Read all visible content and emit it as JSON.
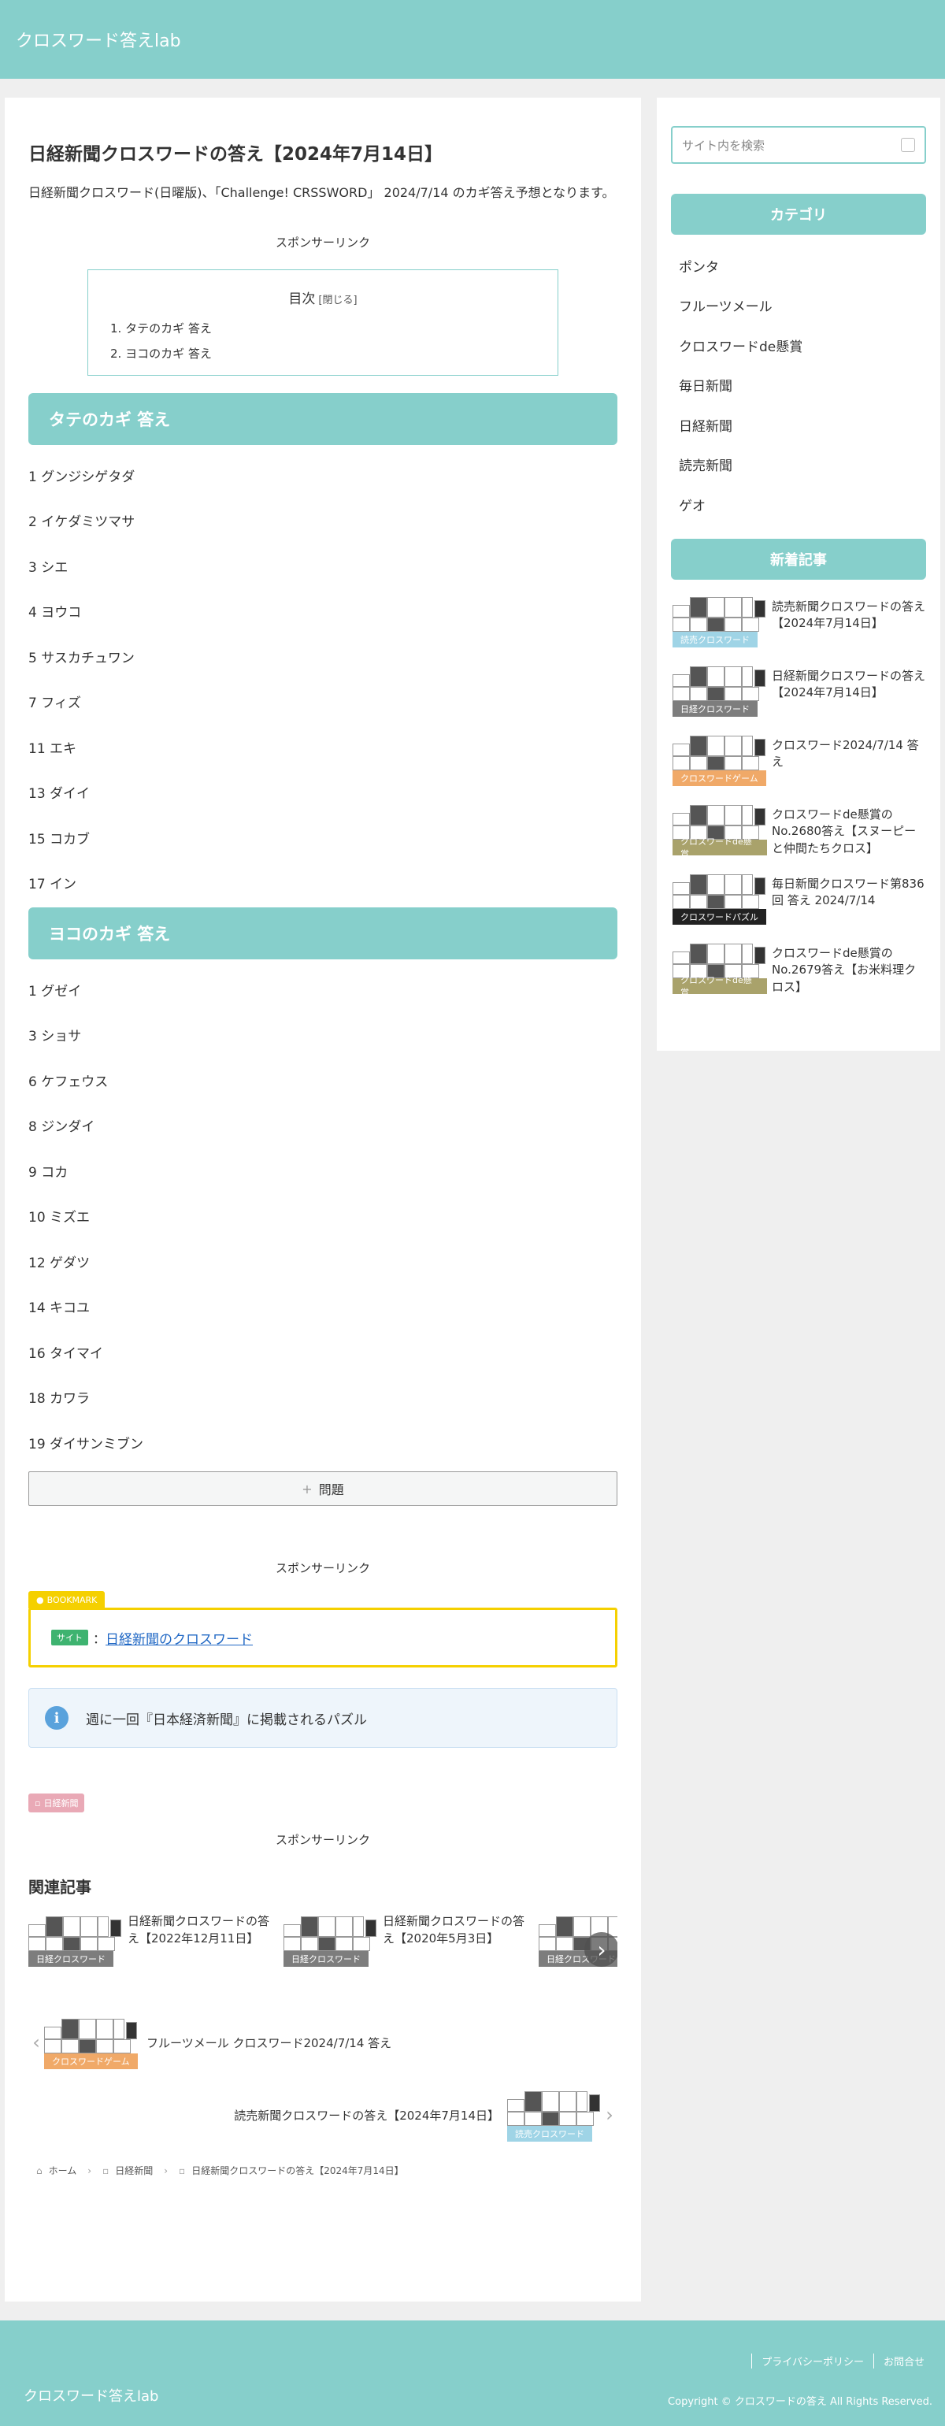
{
  "header": {
    "site_title": "クロスワード答えlab"
  },
  "article": {
    "title": "日経新聞クロスワードの答え【2024年7月14日】",
    "lead": "日経新聞クロスワード(日曜版)、「Challenge! CRSSWORD」 2024/7/14 のカギ答え予想となります。",
    "sponsor_label": "スポンサーリンク",
    "toc": {
      "title": "目次",
      "toggle": "[閉じる]",
      "items": [
        "1. タテのカギ 答え",
        "2. ヨコのカギ 答え"
      ]
    },
    "tate_heading": "タテのカギ 答え",
    "tate_answers": [
      "1 グンジシゲタダ",
      "2 イケダミツマサ",
      "3 シエ",
      "4 ヨウコ",
      "5 サスカチュワン",
      "7 フィズ",
      "11 エキ",
      "13 ダイイ",
      "15 コカブ",
      "17 イン"
    ],
    "yoko_heading": "ヨコのカギ 答え",
    "yoko_answers": [
      "1 グゼイ",
      "3 ショサ",
      "6 ケフェウス",
      "8 ジンダイ",
      "9 コカ",
      "10 ミズエ",
      "12 ゲダツ",
      "14 キコユ",
      "16 タイマイ",
      "18 カワラ",
      "19 ダイサンミブン"
    ],
    "toggle_button": {
      "icon": "+",
      "label": "問題"
    },
    "bookmark": {
      "tag": "BOOKMARK",
      "badge": "サイト",
      "separator": "：",
      "link_text": "日経新聞のクロスワード"
    },
    "info_text": "週に一回『日本経済新聞』に掲載されるパズル",
    "category_tag": "日経新聞",
    "related": {
      "heading": "関連記事",
      "items": [
        {
          "title": "日経新聞クロスワードの答え【2022年12月11日】",
          "label": "日経クロスワード",
          "label_color": "#7d7d7d"
        },
        {
          "title": "日経新聞クロスワードの答え【2020年5月3日】",
          "label": "日経クロスワード",
          "label_color": "#7d7d7d"
        },
        {
          "title": "",
          "label": "日経クロスワード",
          "label_color": "#7d7d7d"
        }
      ]
    },
    "prev": {
      "title": "フルーツメール クロスワード2024/7/14 答え",
      "label": "クロスワードゲーム",
      "label_color": "#f0a968"
    },
    "next": {
      "title": "読売新聞クロスワードの答え【2024年7月14日】",
      "label": "読売クロスワード",
      "label_color": "#9fd4e6"
    },
    "breadcrumb": [
      "ホーム",
      "日経新聞",
      "日経新聞クロスワードの答え【2024年7月14日】"
    ]
  },
  "sidebar": {
    "search_placeholder": "サイト内を検索",
    "category_heading": "カテゴリ",
    "categories": [
      "ポンタ",
      "フルーツメール",
      "クロスワードde懸賞",
      "毎日新聞",
      "日経新聞",
      "読売新聞",
      "ゲオ"
    ],
    "new_heading": "新着記事",
    "new_items": [
      {
        "title": "読売新聞クロスワードの答え【2024年7月14日】",
        "label": "読売クロスワード",
        "label_color": "#9fd4e6"
      },
      {
        "title": "日経新聞クロスワードの答え【2024年7月14日】",
        "label": "日経クロスワード",
        "label_color": "#7d7d7d"
      },
      {
        "title": "クロスワード2024/7/14 答え",
        "label": "クロスワードゲーム",
        "label_color": "#f0a968"
      },
      {
        "title": "クロスワードde懸賞のNo.2680答え【スヌーピーと仲間たちクロス】",
        "label": "クロスワードde懸賞",
        "label_color": "#a9a26b"
      },
      {
        "title": "毎日新聞クロスワード第836回 答え 2024/7/14",
        "label": "クロスワードパズル",
        "label_color": "#222222"
      },
      {
        "title": "クロスワードde懸賞のNo.2679答え【お米料理クロス】",
        "label": "クロスワードde懸賞",
        "label_color": "#a9a26b"
      }
    ]
  },
  "footer": {
    "site_title": "クロスワード答えlab",
    "nav": [
      "プライバシーポリシー",
      "お問合せ"
    ],
    "copyright": "Copyright © クロスワードの答え All Rights Reserved."
  }
}
